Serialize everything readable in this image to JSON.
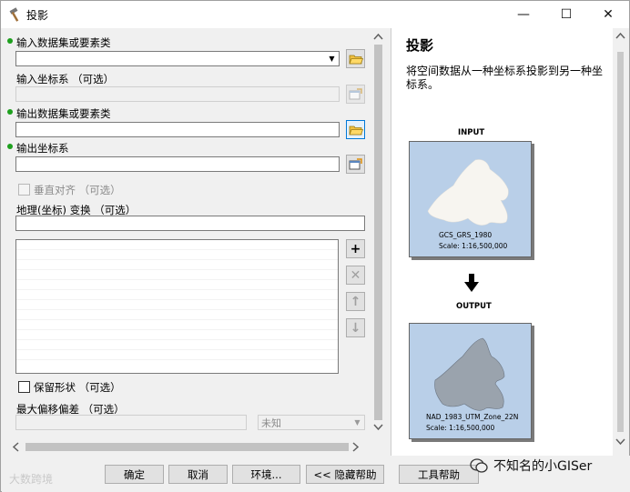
{
  "window": {
    "title": "投影"
  },
  "titlebar_buttons": {
    "minimize": "—",
    "maximize": "☐",
    "close": "✕"
  },
  "form": {
    "input_dataset_label": "输入数据集或要素类",
    "input_dataset_value": "",
    "input_cs_label": "输入坐标系 （可选）",
    "output_dataset_label": "输出数据集或要素类",
    "output_dataset_value": "",
    "output_cs_label": "输出坐标系",
    "output_cs_value": "",
    "vertical_label": "垂直对齐 （可选）",
    "geo_transform_label": "地理(坐标) 变换 （可选）",
    "preserve_shape_label": "保留形状 （可选）",
    "max_offset_label": "最大偏移偏差 （可选）",
    "max_offset_unit": "未知"
  },
  "help": {
    "title": "投影",
    "description": "将空间数据从一种坐标系投影到另一种坐标系。",
    "input_label": "INPUT",
    "output_label": "OUTPUT",
    "input_cs": "GCS_GRS_1980",
    "input_scale": "Scale: 1:16,500,000",
    "output_cs": "NAD_1983_UTM_Zone_22N",
    "output_scale": "Scale: 1:16,500,000"
  },
  "buttons": {
    "ok": "确定",
    "cancel": "取消",
    "environments": "环境...",
    "hide_help": "<< 隐藏帮助",
    "tool_help": "工具帮助"
  },
  "watermarks": {
    "left": "大数跨境",
    "right": "不知名的小GISer"
  },
  "colors": {
    "required_dot": "#1ea01e",
    "map_water": "#b9cfe8",
    "focus_border": "#0078d7"
  },
  "icons": {
    "title": "hammer-icon",
    "open_folder": "folder-open-icon",
    "properties": "properties-icon",
    "add": "plus-icon",
    "remove": "x-icon",
    "up": "arrow-up-icon",
    "down": "arrow-down-icon"
  }
}
